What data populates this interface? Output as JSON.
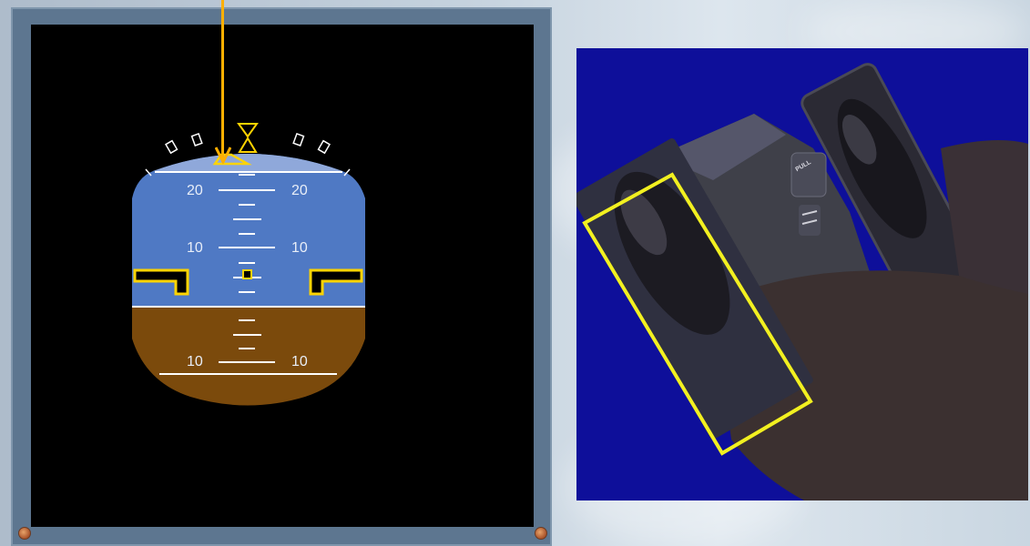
{
  "attitude_indicator": {
    "pitch_labels": {
      "up20_left": "20",
      "up20_right": "20",
      "up10_left": "10",
      "up10_right": "10",
      "down10_left": "10",
      "down10_right": "10"
    }
  },
  "pedal_view": {
    "pedal_button_label": "PULL"
  },
  "colors": {
    "sky": "#4f79c4",
    "ground": "#7b4a0c",
    "screen": "#000000",
    "symbol_yellow": "#ffd400",
    "pointer_orange": "#ffb000",
    "pedal_background": "#0e0f9a",
    "highlight_box": "#f2f020"
  }
}
